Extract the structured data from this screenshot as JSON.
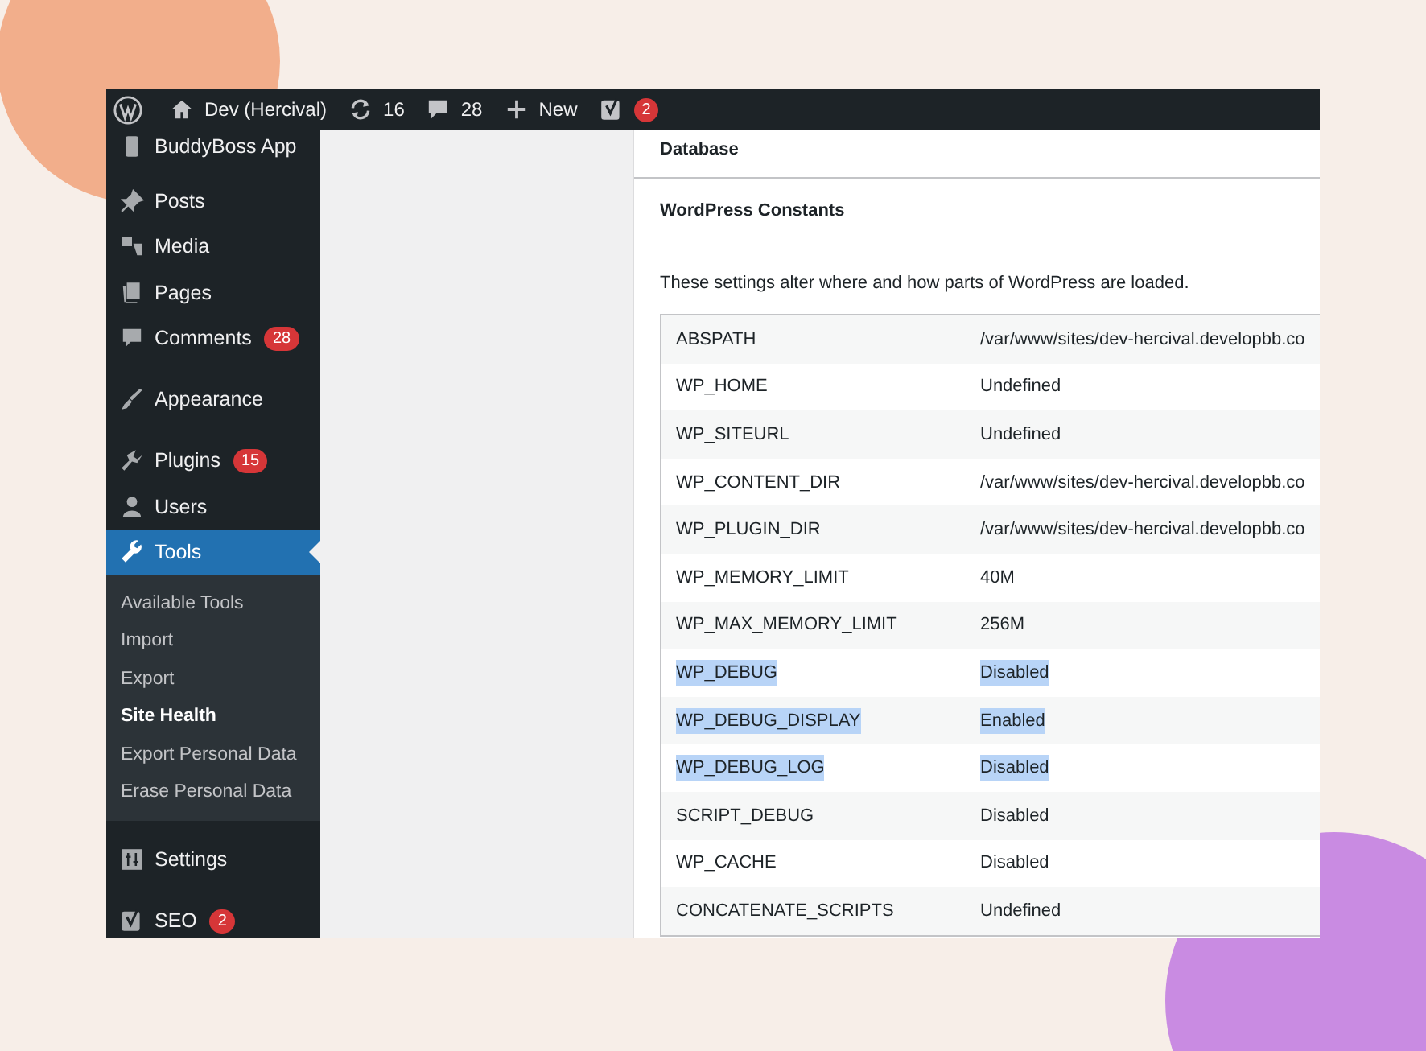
{
  "admin_bar": {
    "site": "Dev (Hercival)",
    "updates": "16",
    "comments": "28",
    "new": "New",
    "seo_badge": "2"
  },
  "sidebar": {
    "groups": [
      [
        {
          "label": "BuddyBoss App",
          "selected": false
        }
      ],
      [
        {
          "label": "Posts",
          "selected": false
        },
        {
          "label": "Media",
          "selected": false
        },
        {
          "label": "Pages",
          "selected": false
        },
        {
          "label": "Comments",
          "selected": false,
          "badge": "28"
        }
      ],
      [
        {
          "label": "Appearance",
          "selected": false
        }
      ],
      [
        {
          "label": "Plugins",
          "selected": false,
          "badge": "15"
        },
        {
          "label": "Users",
          "selected": false
        },
        {
          "label": "Tools",
          "selected": true,
          "children": [
            {
              "label": "Available Tools",
              "selected": false
            },
            {
              "label": "Import",
              "selected": false
            },
            {
              "label": "Export",
              "selected": false
            },
            {
              "label": "Site Health",
              "selected": true
            },
            {
              "label": "Export Personal Data",
              "selected": false
            },
            {
              "label": "Erase Personal Data",
              "selected": false
            }
          ]
        }
      ],
      [
        {
          "label": "Settings",
          "selected": false
        }
      ],
      [
        {
          "label": "SEO",
          "selected": false,
          "badge": "2"
        }
      ]
    ]
  },
  "panel": {
    "section": "Database",
    "heading": "WordPress Constants",
    "description": "These settings alter where and how parts of WordPress are loaded.",
    "rows": [
      {
        "name": "ABSPATH",
        "value": "/var/www/sites/dev-hercival.developbb.co",
        "selected": false
      },
      {
        "name": "WP_HOME",
        "value": "Undefined",
        "selected": false
      },
      {
        "name": "WP_SITEURL",
        "value": "Undefined",
        "selected": false
      },
      {
        "name": "WP_CONTENT_DIR",
        "value": "/var/www/sites/dev-hercival.developbb.co",
        "selected": false
      },
      {
        "name": "WP_PLUGIN_DIR",
        "value": "/var/www/sites/dev-hercival.developbb.co",
        "selected": false
      },
      {
        "name": "WP_MEMORY_LIMIT",
        "value": "40M",
        "selected": false
      },
      {
        "name": "WP_MAX_MEMORY_LIMIT",
        "value": "256M",
        "selected": false
      },
      {
        "name": "WP_DEBUG",
        "value": "Disabled",
        "selected": true
      },
      {
        "name": "WP_DEBUG_DISPLAY",
        "value": "Enabled",
        "selected": true
      },
      {
        "name": "WP_DEBUG_LOG",
        "value": "Disabled",
        "selected": true
      },
      {
        "name": "SCRIPT_DEBUG",
        "value": "Disabled",
        "selected": false
      },
      {
        "name": "WP_CACHE",
        "value": "Disabled",
        "selected": false
      },
      {
        "name": "CONCATENATE_SCRIPTS",
        "value": "Undefined",
        "selected": false
      }
    ]
  }
}
